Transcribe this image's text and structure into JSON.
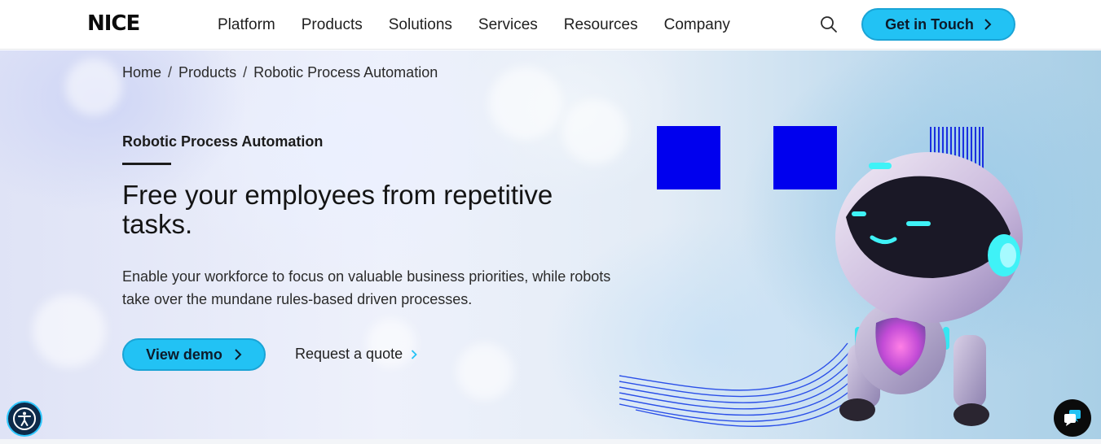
{
  "header": {
    "logo_text": "NICE",
    "nav": [
      {
        "label": "Platform"
      },
      {
        "label": "Products"
      },
      {
        "label": "Solutions"
      },
      {
        "label": "Services"
      },
      {
        "label": "Resources"
      },
      {
        "label": "Company"
      }
    ],
    "search_icon": "search-icon",
    "cta_label": "Get in Touch",
    "cta_icon": "chevron-right-icon"
  },
  "breadcrumb": {
    "items": [
      "Home",
      "Products"
    ],
    "current": "Robotic Process Automation",
    "separator": "/"
  },
  "hero": {
    "eyebrow": "Robotic Process Automation",
    "headline": "Free your employees from repetitive tasks.",
    "subcopy": "Enable your workforce to focus on valuable business priorities, while robots take over the mundane rules-based driven processes.",
    "primary_cta": "View demo",
    "secondary_cta": "Request a quote",
    "image_icon": "robot-illustration"
  },
  "widgets": {
    "accessibility_icon": "accessibility-icon",
    "chat_icon": "chat-icon"
  },
  "colors": {
    "accent": "#22c2f4",
    "accent_border": "#1aa4d6",
    "square_blue": "#0000ee",
    "text_dark": "#141414"
  }
}
